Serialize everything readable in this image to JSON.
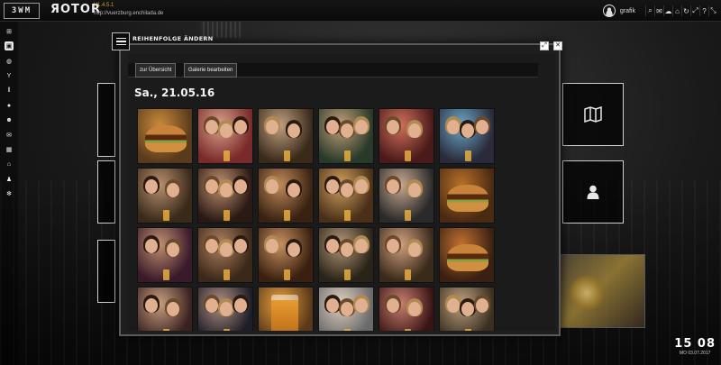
{
  "app": {
    "logo": "3WM",
    "brand": "ЯOTOR",
    "version": "V1.4.5.1",
    "url": "http://vuerzburg.enchilada.de",
    "username": "grafik"
  },
  "colors": {
    "accent_version": "#c9a52a",
    "modal_bg": "#1e1e1e",
    "tile_border": "#cfcfcf"
  },
  "topbar_tools": [
    {
      "name": "search-icon",
      "glyph": "⌕"
    },
    {
      "name": "chat-icon",
      "glyph": "✉"
    },
    {
      "name": "cloud-icon",
      "glyph": "☁"
    },
    {
      "name": "home-icon",
      "glyph": "⌂"
    },
    {
      "name": "refresh-icon",
      "glyph": "↻"
    },
    {
      "name": "fullscreen-icon",
      "glyph": "⤢"
    },
    {
      "name": "help-icon",
      "glyph": "?"
    },
    {
      "name": "expand-icon",
      "glyph": "⤡"
    }
  ],
  "sidebar": [
    {
      "name": "sitemap-icon",
      "glyph": "⊞",
      "active": false
    },
    {
      "name": "pictures-icon",
      "glyph": "▣",
      "active": true
    },
    {
      "name": "globe-icon",
      "glyph": "◍",
      "active": false
    },
    {
      "name": "cocktail-icon",
      "glyph": "Y",
      "active": false
    },
    {
      "name": "cutlery-icon",
      "glyph": "ǁ",
      "active": false
    },
    {
      "name": "location-icon",
      "glyph": "●",
      "active": false
    },
    {
      "name": "users-icon",
      "glyph": "☻",
      "active": false
    },
    {
      "name": "mail-icon",
      "glyph": "✉",
      "active": false
    },
    {
      "name": "calendar-icon",
      "glyph": "▦",
      "active": false
    },
    {
      "name": "home-icon",
      "glyph": "⌂",
      "active": false
    },
    {
      "name": "user-icon",
      "glyph": "♟",
      "active": false
    },
    {
      "name": "settings-icon",
      "glyph": "✻",
      "active": false
    }
  ],
  "tiles": [
    {
      "name": "map-icon"
    },
    {
      "name": "user-icon"
    }
  ],
  "modal": {
    "title": "REIHENFOLGE ÄNDERN",
    "toolbar": {
      "overview": "zur Übersicht",
      "edit_gallery": "Galerie bearbeiten"
    },
    "date_heading": "Sa., 21.05.16",
    "photos": [
      {
        "theme": "food",
        "c1": "#5a3a1c",
        "c2": "#c98a3a"
      },
      {
        "theme": "people",
        "c1": "#7a2a2a",
        "c2": "#d9a28a"
      },
      {
        "theme": "people",
        "c1": "#3a2a1a",
        "c2": "#c0a080"
      },
      {
        "theme": "people",
        "c1": "#2a3a2a",
        "c2": "#c2a07a"
      },
      {
        "theme": "people",
        "c1": "#4a1a1a",
        "c2": "#d0705a"
      },
      {
        "theme": "people",
        "c1": "#2a2a3a",
        "c2": "#6aa8c8"
      },
      {
        "theme": "people",
        "c1": "#3a2a1a",
        "c2": "#b89070"
      },
      {
        "theme": "people",
        "c1": "#2a1a14",
        "c2": "#c09070"
      },
      {
        "theme": "people",
        "c1": "#3a2212",
        "c2": "#c08a5a"
      },
      {
        "theme": "people",
        "c1": "#4a3018",
        "c2": "#d0a060"
      },
      {
        "theme": "people",
        "c1": "#2a2a2a",
        "c2": "#c8a890"
      },
      {
        "theme": "food",
        "c1": "#4a2a12",
        "c2": "#b8702a"
      },
      {
        "theme": "people",
        "c1": "#3a1a2a",
        "c2": "#c09070"
      },
      {
        "theme": "people",
        "c1": "#3a2818",
        "c2": "#b08060"
      },
      {
        "theme": "people",
        "c1": "#3a2010",
        "c2": "#c89060"
      },
      {
        "theme": "people",
        "c1": "#2a2418",
        "c2": "#b49878"
      },
      {
        "theme": "people",
        "c1": "#3a2a1a",
        "c2": "#d0a080"
      },
      {
        "theme": "food",
        "c1": "#3a2012",
        "c2": "#c07030"
      },
      {
        "theme": "people",
        "c1": "#3a2020",
        "c2": "#c8a080"
      },
      {
        "theme": "people",
        "c1": "#1e1e28",
        "c2": "#b09080"
      },
      {
        "theme": "drink",
        "c1": "#5a3818",
        "c2": "#e8a040"
      },
      {
        "theme": "people",
        "c1": "#6a6a6a",
        "c2": "#e0d0c0"
      },
      {
        "theme": "people",
        "c1": "#3a1414",
        "c2": "#c88070"
      },
      {
        "theme": "people",
        "c1": "#3a3020",
        "c2": "#c0a080"
      }
    ]
  }
}
